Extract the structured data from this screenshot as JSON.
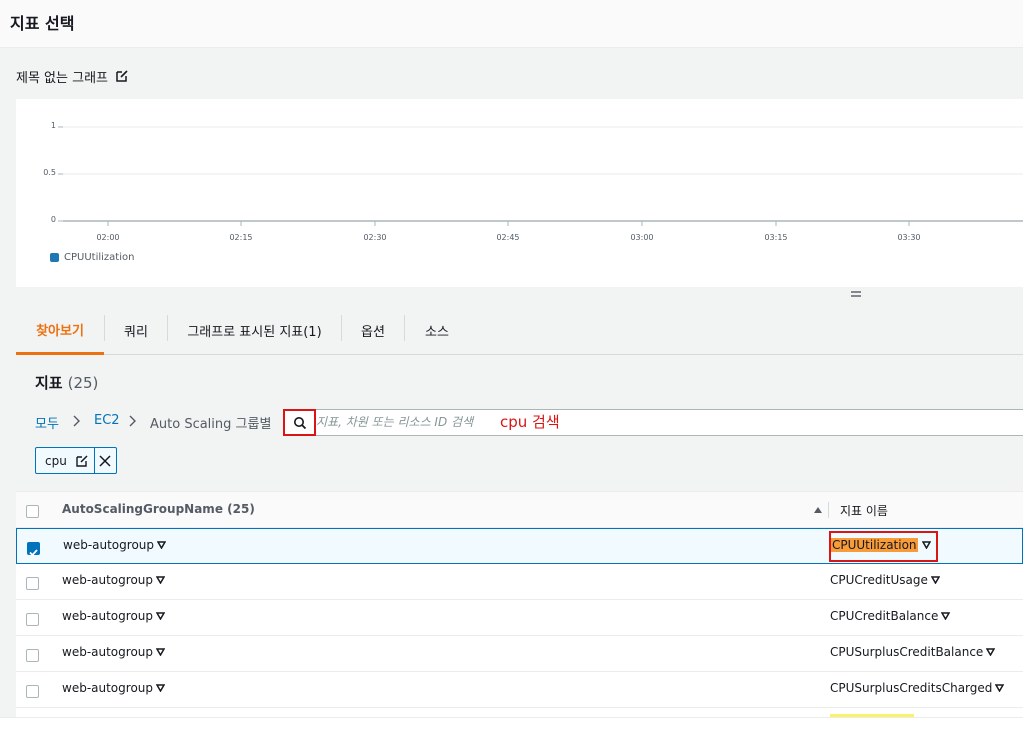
{
  "header": {
    "title": "지표 선택"
  },
  "graph": {
    "title": "제목 없는 그래프",
    "y_ticks": [
      "1",
      "0.5",
      "0"
    ],
    "x_ticks": [
      "02:00",
      "02:15",
      "02:30",
      "02:45",
      "03:00",
      "03:15",
      "03:30"
    ],
    "legend_label": "CPUUtilization",
    "legend_color": "#1f77b4"
  },
  "tabs": [
    {
      "label": "찾아보기",
      "active": true
    },
    {
      "label": "쿼리"
    },
    {
      "label": "그래프로 표시된 지표(1)"
    },
    {
      "label": "옵션"
    },
    {
      "label": "소스"
    }
  ],
  "panel": {
    "title": "지표",
    "count": "(25)",
    "breadcrumb": {
      "root": "모두",
      "mid": "EC2",
      "current": "Auto Scaling 그룹별"
    },
    "search_placeholder": "지표, 차원 또는 리소스 ID 검색",
    "annotation": "cpu 검색",
    "token": "cpu"
  },
  "table": {
    "col1": "AutoScalingGroupName (25)",
    "col2": "지표 이름",
    "rows": [
      {
        "group": "web-autogroup",
        "metric": "CPUUtilization",
        "checked": true
      },
      {
        "group": "web-autogroup",
        "metric": "CPUCreditUsage",
        "checked": false
      },
      {
        "group": "web-autogroup",
        "metric": "CPUCreditBalance",
        "checked": false
      },
      {
        "group": "web-autogroup",
        "metric": "CPUSurplusCreditBalance",
        "checked": false
      },
      {
        "group": "web-autogroup",
        "metric": "CPUSurplusCreditsCharged",
        "checked": false
      }
    ]
  },
  "colors": {
    "accent": "#ec7211",
    "link": "#0073bb",
    "annotation": "#d91515",
    "highlight": "#f89c3a"
  }
}
